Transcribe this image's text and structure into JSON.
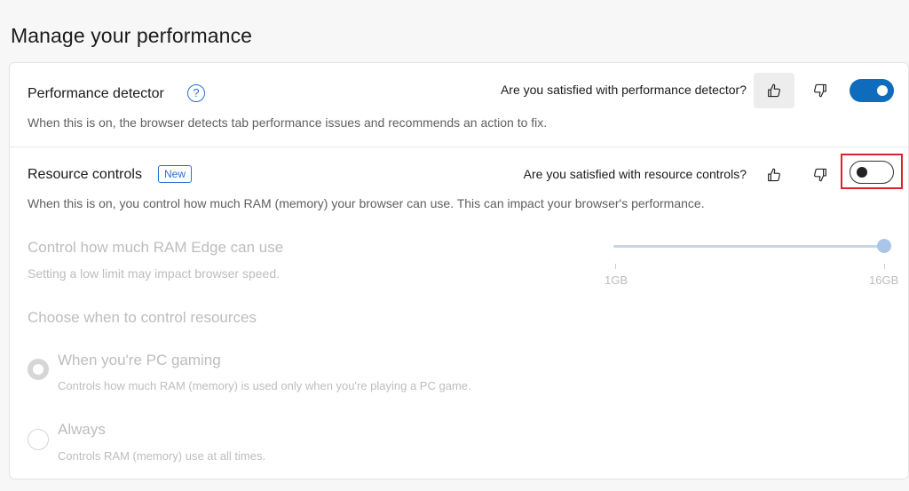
{
  "page": {
    "title": "Manage your performance"
  },
  "performance_detector": {
    "title": "Performance detector",
    "help_glyph": "?",
    "description": "When this is on, the browser detects tab performance issues and recommends an action to fix.",
    "feedback_question": "Are you satisfied with performance detector?",
    "toggle_state": "on"
  },
  "resource_controls": {
    "title": "Resource controls",
    "badge": "New",
    "description": "When this is on, you control how much RAM (memory) your browser can use. This can impact your browser's performance.",
    "feedback_question": "Are you satisfied with resource controls?",
    "toggle_state": "off",
    "ram": {
      "title": "Control how much RAM Edge can use",
      "description": "Setting a low limit may impact browser speed.",
      "min_label": "1GB",
      "max_label": "16GB",
      "value_fraction": 1.0
    },
    "when": {
      "title": "Choose when to control resources",
      "options": [
        {
          "label": "When you're PC gaming",
          "description": "Controls how much RAM (memory) is used only when you're playing a PC game.",
          "checked": true
        },
        {
          "label": "Always",
          "description": "Controls RAM (memory) use at all times.",
          "checked": false
        }
      ]
    }
  },
  "colors": {
    "accent": "#0f6cbd",
    "highlight": "#d9232d",
    "disabled_text": "#bdbdbd"
  },
  "icons": {
    "thumbs_up": "thumbs-up-icon",
    "thumbs_down": "thumbs-down-icon"
  }
}
